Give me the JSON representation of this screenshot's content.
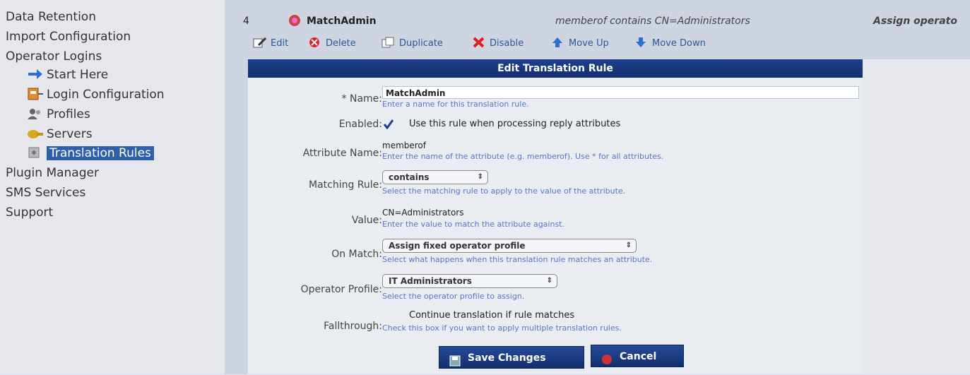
{
  "sidebar": {
    "items": [
      {
        "label": "Data Retention"
      },
      {
        "label": "Import Configuration"
      },
      {
        "label": "Operator Logins"
      },
      {
        "label": "Start Here"
      },
      {
        "label": "Login Configuration"
      },
      {
        "label": "Profiles"
      },
      {
        "label": "Servers"
      },
      {
        "label": "Translation Rules"
      },
      {
        "label": "Plugin Manager"
      },
      {
        "label": "SMS Services"
      },
      {
        "label": "Support"
      }
    ]
  },
  "row": {
    "num": "4",
    "name": "MatchAdmin",
    "condition": "memberof contains CN=Administrators",
    "action": "Assign operato"
  },
  "toolbar": {
    "edit": "Edit",
    "delete": "Delete",
    "duplicate": "Duplicate",
    "disable": "Disable",
    "move_up": "Move Up",
    "move_down": "Move Down"
  },
  "form": {
    "title": "Edit Translation Rule",
    "name": {
      "label": "* Name:",
      "value": "MatchAdmin",
      "hint": "Enter a name for this translation rule."
    },
    "enabled": {
      "label": "Enabled:",
      "checkbox_text": "Use this rule when processing reply attributes",
      "checked": true
    },
    "attribute_name": {
      "label": "Attribute Name:",
      "value": "memberof",
      "hint": "Enter the name of the attribute (e.g. memberof). Use * for all attributes."
    },
    "matching_rule": {
      "label": "Matching Rule:",
      "value": "contains",
      "hint": "Select the matching rule to apply to the value of the attribute."
    },
    "value": {
      "label": "Value:",
      "value": "CN=Administrators",
      "hint": "Enter the value to match the attribute against."
    },
    "on_match": {
      "label": "On Match:",
      "value": "Assign fixed operator profile",
      "hint": "Select what happens when this translation rule matches an attribute."
    },
    "operator_profile": {
      "label": "Operator Profile:",
      "value": "IT Administrators",
      "hint": "Select the operator profile to assign."
    },
    "fallthrough": {
      "label": "Fallthrough:",
      "checkbox_text": "Continue translation if rule matches",
      "hint": "Check this box if you want to apply multiple translation rules.",
      "checked": false
    },
    "save_label": "Save Changes",
    "cancel_label": "Cancel"
  },
  "colors": {
    "header_blue": "#1d3f8c",
    "hint_blue": "#5577cc",
    "selected_blue": "#2f5fa8"
  }
}
